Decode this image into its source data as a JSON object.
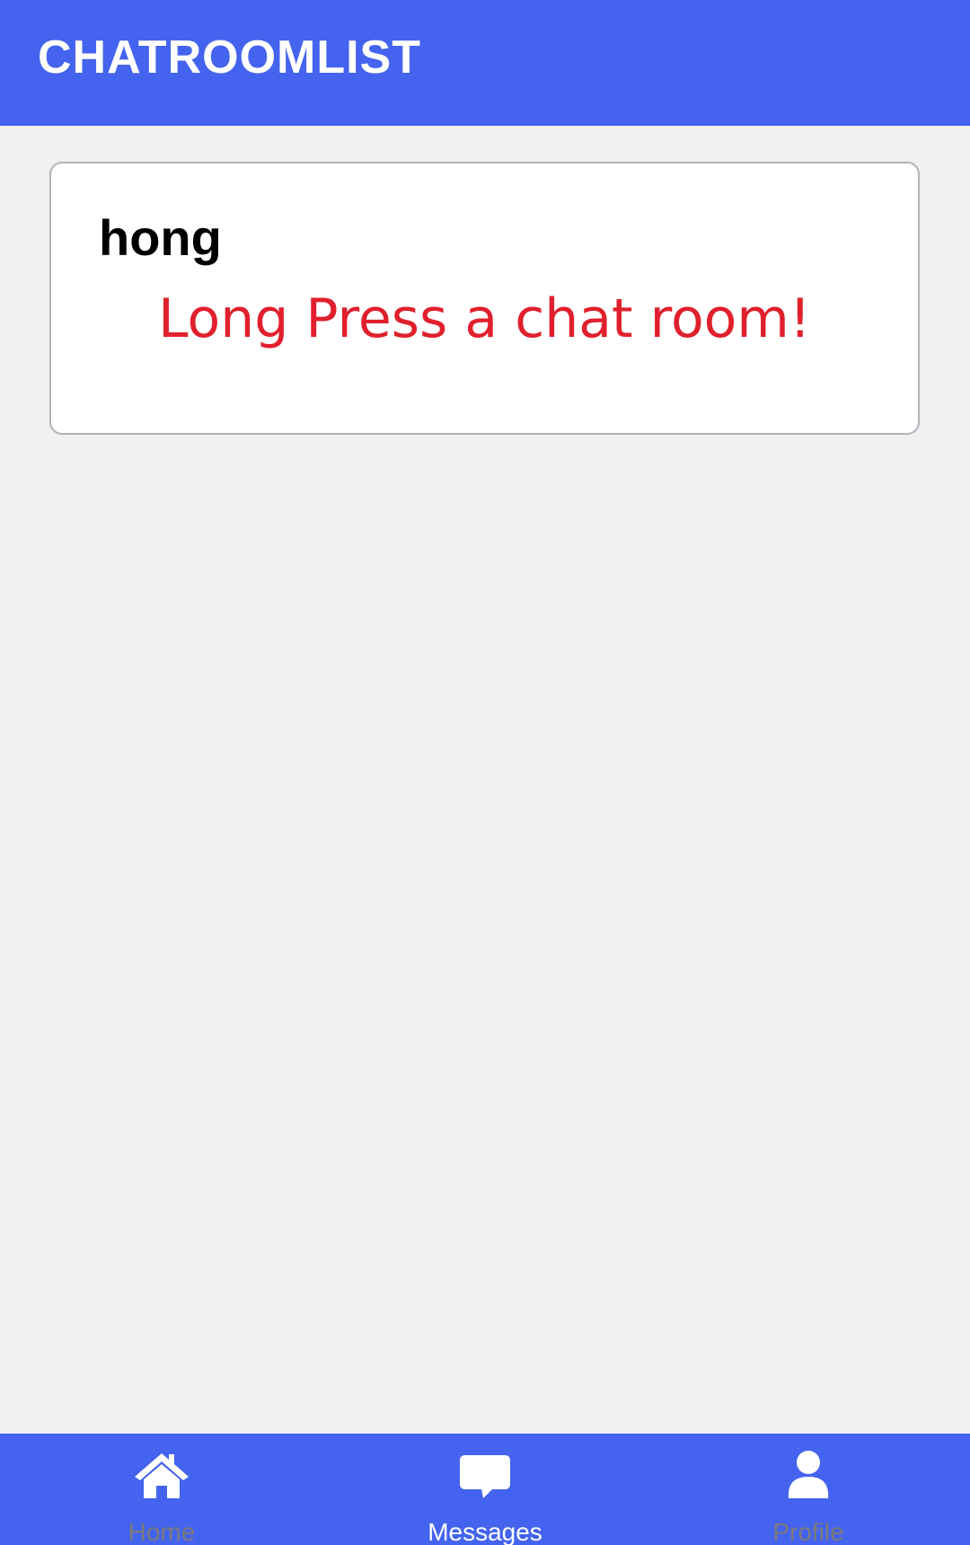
{
  "header": {
    "title": "CHATROOMLIST"
  },
  "chat_rooms": [
    {
      "name": "hong",
      "hint": "Long Press a chat room!"
    }
  ],
  "bottom_nav": {
    "items": [
      {
        "label": "Home",
        "icon": "home-icon",
        "active": false
      },
      {
        "label": "Messages",
        "icon": "chat-bubble-icon",
        "active": true
      },
      {
        "label": "Profile",
        "icon": "user-icon",
        "active": false
      }
    ]
  },
  "colors": {
    "primary": "#4463ee",
    "background": "#f1f1f1",
    "hint_text": "#e0202c",
    "inactive_label": "#7b7b7b",
    "active_label": "#ffffff"
  }
}
